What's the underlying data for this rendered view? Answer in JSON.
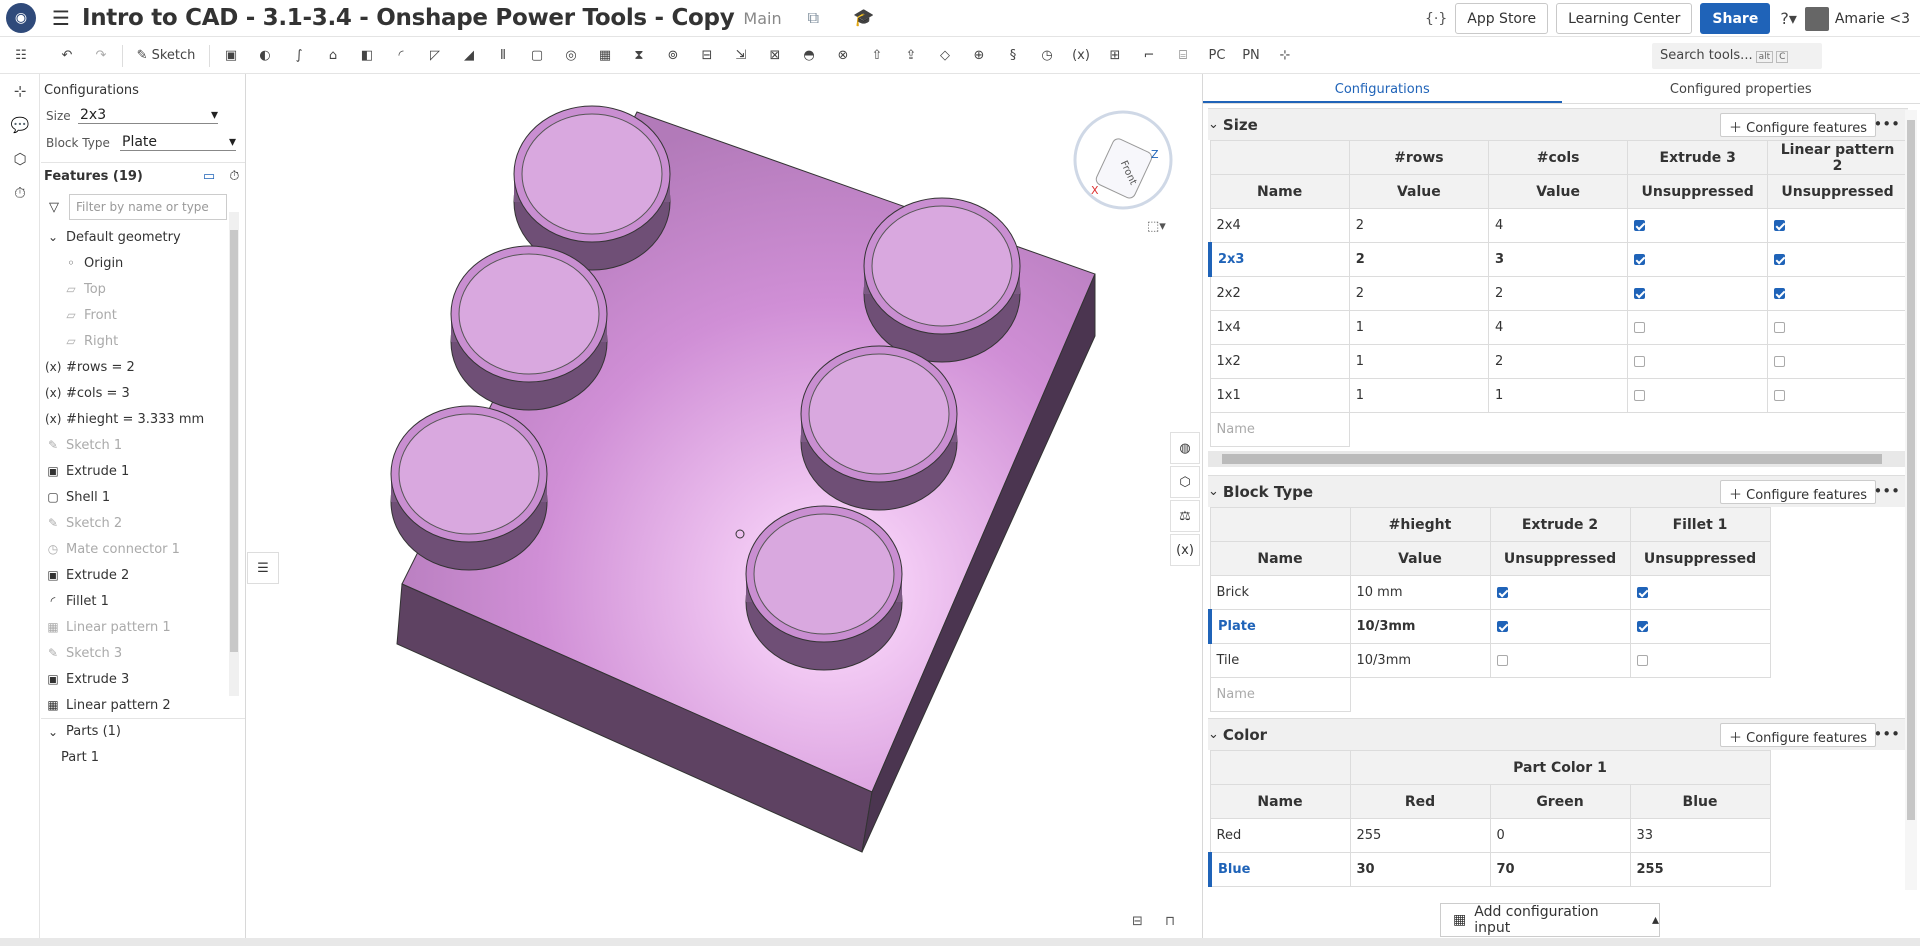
{
  "header": {
    "title": "Intro to CAD - 3.1-3.4 - Onshape Power Tools - Copy",
    "branch": "Main",
    "app_store": "App Store",
    "learning_center": "Learning Center",
    "share": "Share",
    "user": "Amarie <3"
  },
  "toolbar": {
    "sketch": "Sketch",
    "search": "Search tools...",
    "search_kbd1": "alt",
    "search_kbd2": "C"
  },
  "left": {
    "configurations": "Configurations",
    "size_label": "Size",
    "size_value": "2x3",
    "blocktype_label": "Block Type",
    "blocktype_value": "Plate",
    "features": "Features (19)",
    "filter_placeholder": "Filter by name or type",
    "items": [
      {
        "label": "Default geometry",
        "dim": false,
        "icon": "chevron-down"
      },
      {
        "label": "Origin",
        "dim": false,
        "icon": "origin"
      },
      {
        "label": "Top",
        "dim": true,
        "icon": "plane"
      },
      {
        "label": "Front",
        "dim": true,
        "icon": "plane"
      },
      {
        "label": "Right",
        "dim": true,
        "icon": "plane"
      },
      {
        "label": "#rows = 2",
        "dim": false,
        "icon": "variable"
      },
      {
        "label": "#cols = 3",
        "dim": false,
        "icon": "variable"
      },
      {
        "label": "#hieght = 3.333 mm",
        "dim": false,
        "icon": "variable"
      },
      {
        "label": "Sketch 1",
        "dim": true,
        "icon": "sketch"
      },
      {
        "label": "Extrude 1",
        "dim": false,
        "icon": "extrude"
      },
      {
        "label": "Shell 1",
        "dim": false,
        "icon": "shell"
      },
      {
        "label": "Sketch 2",
        "dim": true,
        "icon": "sketch"
      },
      {
        "label": "Mate connector 1",
        "dim": true,
        "icon": "mate"
      },
      {
        "label": "Extrude 2",
        "dim": false,
        "icon": "extrude"
      },
      {
        "label": "Fillet 1",
        "dim": false,
        "icon": "fillet"
      },
      {
        "label": "Linear pattern 1",
        "dim": true,
        "icon": "pattern"
      },
      {
        "label": "Sketch 3",
        "dim": true,
        "icon": "sketch"
      },
      {
        "label": "Extrude 3",
        "dim": false,
        "icon": "extrude"
      },
      {
        "label": "Linear pattern 2",
        "dim": false,
        "icon": "pattern"
      }
    ],
    "parts_header": "Parts (1)",
    "part1": "Part 1"
  },
  "right": {
    "tab1": "Configurations",
    "tab2": "Configured properties",
    "configure": "Configure features",
    "add_config": "Add configuration input",
    "name_placeholder": "Name",
    "size": {
      "title": "Size",
      "headers": [
        "#rows",
        "#cols",
        "Extrude 3",
        "Linear pattern 2"
      ],
      "sub": [
        "Name",
        "Value",
        "Value",
        "Unsuppressed",
        "Unsuppressed"
      ],
      "rows": [
        [
          "2x4",
          "2",
          "4",
          true,
          true
        ],
        [
          "2x3",
          "2",
          "3",
          true,
          true
        ],
        [
          "2x2",
          "2",
          "2",
          true,
          true
        ],
        [
          "1x4",
          "1",
          "4",
          false,
          false
        ],
        [
          "1x2",
          "1",
          "2",
          false,
          false
        ],
        [
          "1x1",
          "1",
          "1",
          false,
          false
        ]
      ]
    },
    "block": {
      "title": "Block Type",
      "headers": [
        "#hieght",
        "Extrude 2",
        "Fillet 1"
      ],
      "sub": [
        "Name",
        "Value",
        "Unsuppressed",
        "Unsuppressed"
      ],
      "rows": [
        [
          "Brick",
          "10 mm",
          true,
          true
        ],
        [
          "Plate",
          "10/3mm",
          true,
          true
        ],
        [
          "Tile",
          "10/3mm",
          false,
          false
        ]
      ]
    },
    "color": {
      "title": "Color",
      "group": "Part Color 1",
      "sub": [
        "Name",
        "Red",
        "Green",
        "Blue"
      ],
      "rows": [
        [
          "Red",
          "255",
          "0",
          "33"
        ],
        [
          "Blue",
          "30",
          "70",
          "255"
        ]
      ]
    }
  }
}
